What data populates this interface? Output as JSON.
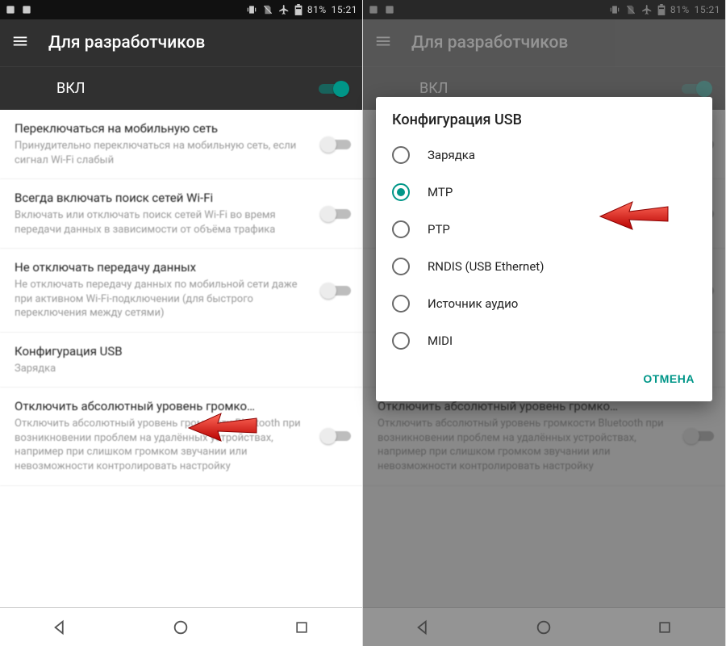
{
  "statusbar": {
    "battery_pct": "81%",
    "clock": "15:21"
  },
  "appbar": {
    "title": "Для разработчиков"
  },
  "master_toggle": {
    "label": "ВКЛ",
    "on": true
  },
  "settings": [
    {
      "title": "Переключаться на мобильную сеть",
      "sub": "Принудительно переключаться на мобильную сеть, если сигнал Wi-Fi слабый",
      "has_switch": true,
      "on": false
    },
    {
      "title": "Всегда включать поиск сетей Wi-Fi",
      "sub": "Включать или отключать поиск сетей Wi-Fi во время передачи данных в зависимости от объёма трафика",
      "has_switch": true,
      "on": false
    },
    {
      "title": "Не отключать передачу данных",
      "sub": "Не отключать передачу данных по мобильной сети даже при активном Wi-Fi-подключении (для быстрого переключения между сетями)",
      "has_switch": true,
      "on": false
    },
    {
      "title": "Конфигурация USB",
      "sub": "Зарядка",
      "has_switch": false
    },
    {
      "title": "Отключить абсолютный уровень громко…",
      "sub": "Отключить абсолютный уровень громкости Bluetooth при возникновении проблем на удалённых устройствах, например при слишком громком звучании или невозможности контролировать настройку",
      "has_switch": true,
      "on": false
    }
  ],
  "dialog": {
    "title": "Конфигурация USB",
    "options": [
      {
        "label": "Зарядка",
        "selected": false
      },
      {
        "label": "MTP",
        "selected": true
      },
      {
        "label": "PTP",
        "selected": false
      },
      {
        "label": "RNDIS (USB Ethernet)",
        "selected": false
      },
      {
        "label": "Источник аудио",
        "selected": false
      },
      {
        "label": "MIDI",
        "selected": false
      }
    ],
    "cancel_label": "ОТМЕНА"
  }
}
